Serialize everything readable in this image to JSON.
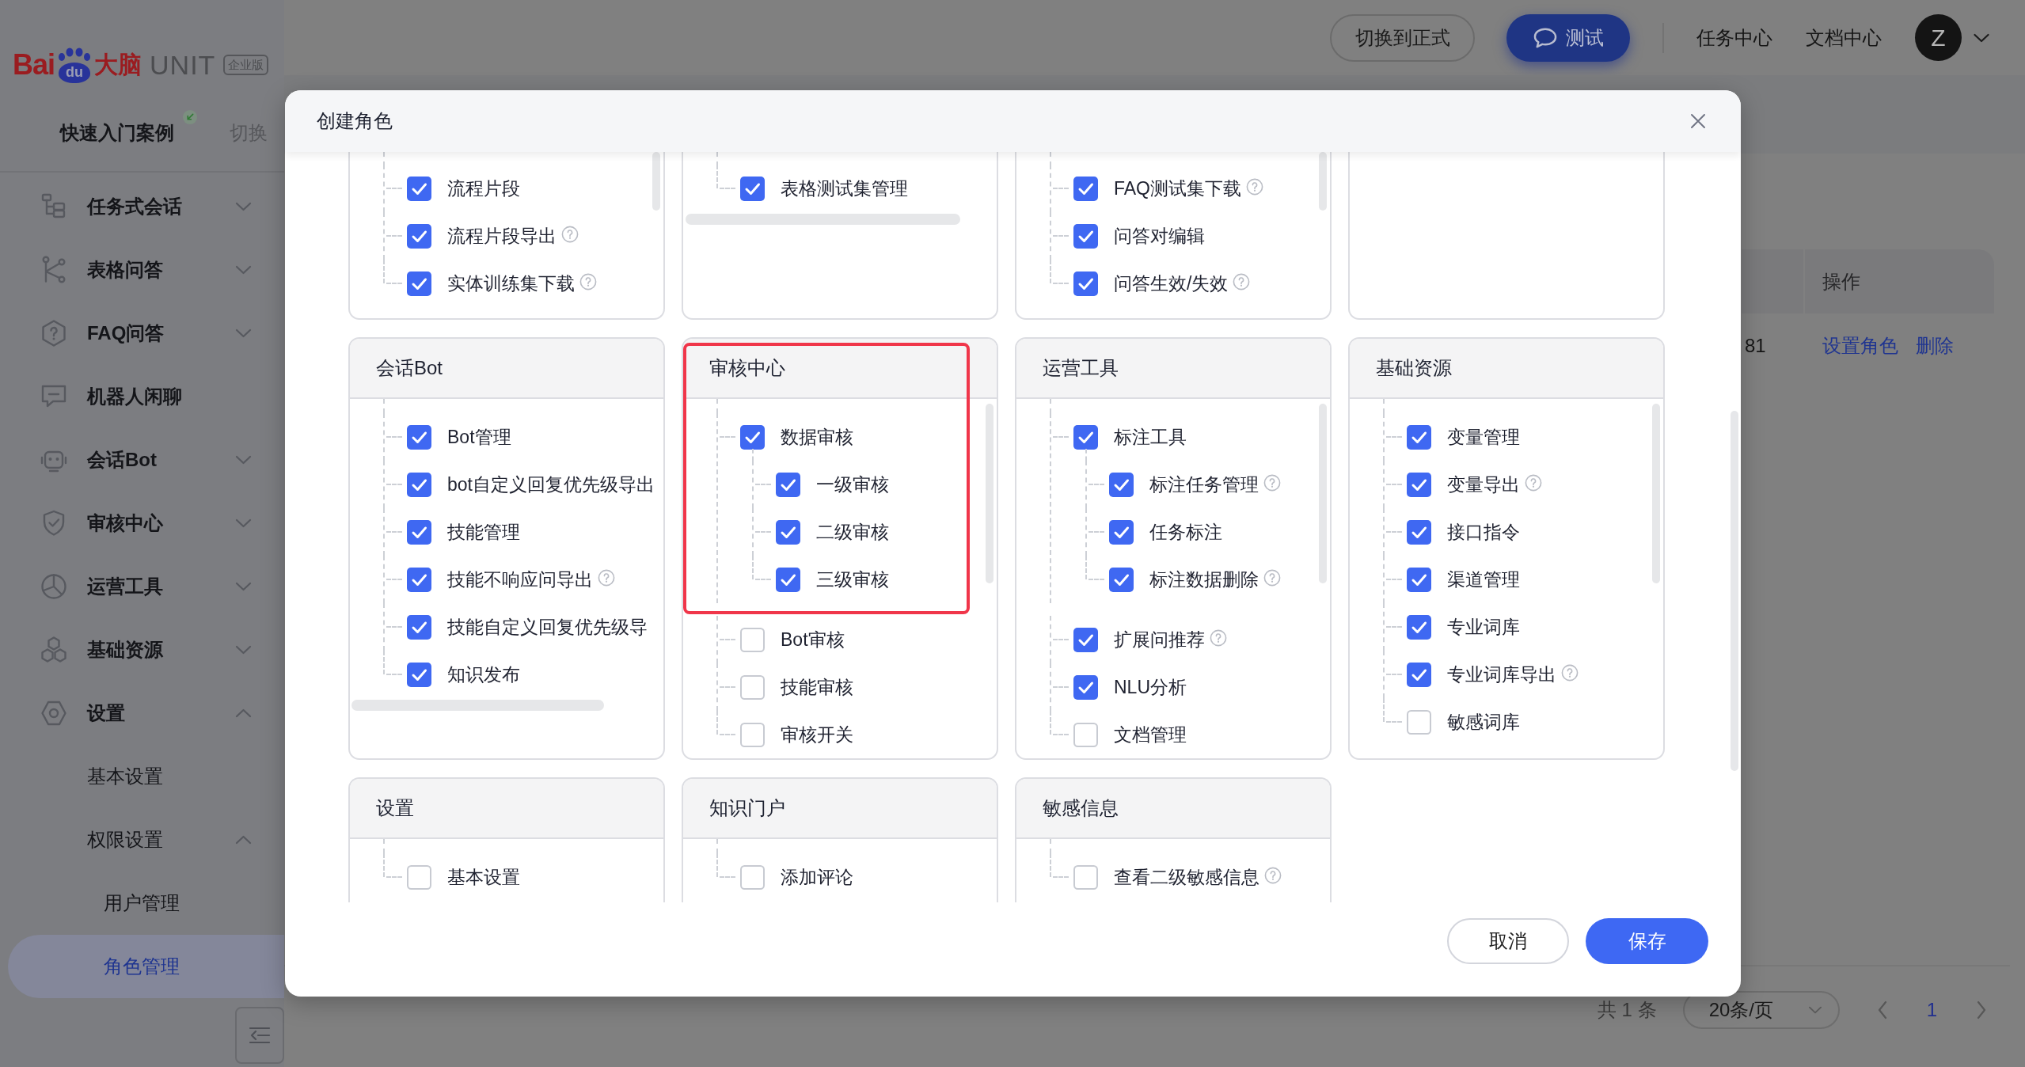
{
  "sidebar": {
    "logo": {
      "brand_latin": "Bai",
      "brand_paw": "du",
      "brand_cn": "大脑",
      "product": "UNIT",
      "edition": "企业版"
    },
    "quick_start": {
      "label": "快速入门案例",
      "switch": "切换"
    },
    "menu": [
      {
        "label": "任务式会话",
        "expanded": false,
        "selected": false
      },
      {
        "label": "表格问答",
        "expanded": false,
        "selected": false
      },
      {
        "label": "FAQ问答",
        "expanded": false,
        "selected": false
      },
      {
        "label": "机器人闲聊",
        "selected": false
      },
      {
        "label": "会话Bot",
        "expanded": false,
        "selected": false
      },
      {
        "label": "审核中心",
        "expanded": false,
        "selected": false
      },
      {
        "label": "运营工具",
        "expanded": false,
        "selected": false
      },
      {
        "label": "基础资源",
        "expanded": false,
        "selected": false
      },
      {
        "label": "设置",
        "expanded": true,
        "selected": false,
        "children": [
          {
            "label": "基本设置",
            "selected": false
          },
          {
            "label": "权限设置",
            "expanded": true,
            "selected": false,
            "children": [
              {
                "label": "用户管理",
                "selected": false
              },
              {
                "label": "角色管理",
                "selected": true
              }
            ]
          }
        ]
      }
    ]
  },
  "topbar": {
    "buttons": [
      {
        "label": "切换到正式",
        "kind": "outline"
      },
      {
        "label": "测试",
        "kind": "primary"
      }
    ],
    "links": [
      "任务中心",
      "文档中心"
    ],
    "avatar": "Z"
  },
  "table": {
    "header": [
      "操作"
    ],
    "rows": [
      {
        "cut_cell": "81",
        "actions": [
          "设置角色",
          "删除"
        ]
      }
    ]
  },
  "pagination": {
    "total": "共 1 条",
    "page_size": "20条/页",
    "pages": [
      {
        "label": "1",
        "selected": true
      }
    ]
  },
  "modal": {
    "title": "创建角色",
    "groups": [
      {
        "kind": "tail",
        "scrollbar_vertical": true,
        "items": [
          {
            "label": "流程片段",
            "checked": true
          },
          {
            "label": "流程片段导出",
            "checked": true,
            "help": true
          },
          {
            "label": "实体训练集下载",
            "checked": true,
            "help": true
          }
        ]
      },
      {
        "kind": "tail",
        "scrollbar_horizontal": true,
        "items": [
          {
            "label": "表格测试集管理",
            "checked": true
          }
        ]
      },
      {
        "kind": "tail",
        "scrollbar_vertical": true,
        "items": [
          {
            "label": "FAQ测试集下载",
            "checked": true,
            "help": true
          },
          {
            "label": "问答对编辑",
            "checked": true
          },
          {
            "label": "问答生效/失效",
            "checked": true,
            "help": true
          }
        ]
      },
      {
        "kind": "tail"
      },
      {
        "kind": "full",
        "title": "会话Bot",
        "scrollbar_horizontal": true,
        "items": [
          {
            "label": "Bot管理",
            "checked": true
          },
          {
            "label": "bot自定义回复优先级导出",
            "checked": true
          },
          {
            "label": "技能管理",
            "checked": true
          },
          {
            "label": "技能不响应问导出",
            "checked": true,
            "help": true
          },
          {
            "label": "技能自定义回复优先级导",
            "checked": true
          },
          {
            "label": "知识发布",
            "checked": true
          }
        ]
      },
      {
        "kind": "full",
        "title": "审核中心",
        "highlight": true,
        "scrollbar_vertical": true,
        "items": [
          {
            "label": "数据审核",
            "checked": true,
            "children": [
              {
                "label": "一级审核",
                "checked": true
              },
              {
                "label": "二级审核",
                "checked": true
              },
              {
                "label": "三级审核",
                "checked": true
              }
            ]
          },
          {
            "label": "Bot审核",
            "checked": false
          },
          {
            "label": "技能审核",
            "checked": false
          },
          {
            "label": "审核开关",
            "checked": false
          }
        ]
      },
      {
        "kind": "full",
        "title": "运营工具",
        "scrollbar_vertical": true,
        "items": [
          {
            "label": "标注工具",
            "checked": true,
            "children": [
              {
                "label": "标注任务管理",
                "checked": true,
                "help": true
              },
              {
                "label": "任务标注",
                "checked": true
              },
              {
                "label": "标注数据删除",
                "checked": true,
                "help": true
              }
            ]
          },
          {
            "label": "扩展问推荐",
            "checked": true,
            "help": true
          },
          {
            "label": "NLU分析",
            "checked": true
          },
          {
            "label": "文档管理",
            "checked": false
          }
        ]
      },
      {
        "kind": "full",
        "title": "基础资源",
        "scrollbar_vertical": true,
        "items": [
          {
            "label": "变量管理",
            "checked": true
          },
          {
            "label": "变量导出",
            "checked": true,
            "help": true
          },
          {
            "label": "接口指令",
            "checked": true
          },
          {
            "label": "渠道管理",
            "checked": true
          },
          {
            "label": "专业词库",
            "checked": true
          },
          {
            "label": "专业词库导出",
            "checked": true,
            "help": true
          },
          {
            "label": "敏感词库",
            "checked": false
          }
        ]
      },
      {
        "kind": "head",
        "title": "设置",
        "items": [
          {
            "label": "基本设置",
            "checked": false
          }
        ]
      },
      {
        "kind": "head",
        "title": "知识门户",
        "items": [
          {
            "label": "添加评论",
            "checked": false
          }
        ]
      },
      {
        "kind": "head",
        "title": "敏感信息",
        "items": [
          {
            "label": "查看二级敏感信息",
            "checked": false,
            "help": true
          }
        ]
      }
    ],
    "buttons": [
      {
        "label": "取消",
        "kind": "secondary"
      },
      {
        "label": "保存",
        "kind": "primary"
      }
    ]
  }
}
